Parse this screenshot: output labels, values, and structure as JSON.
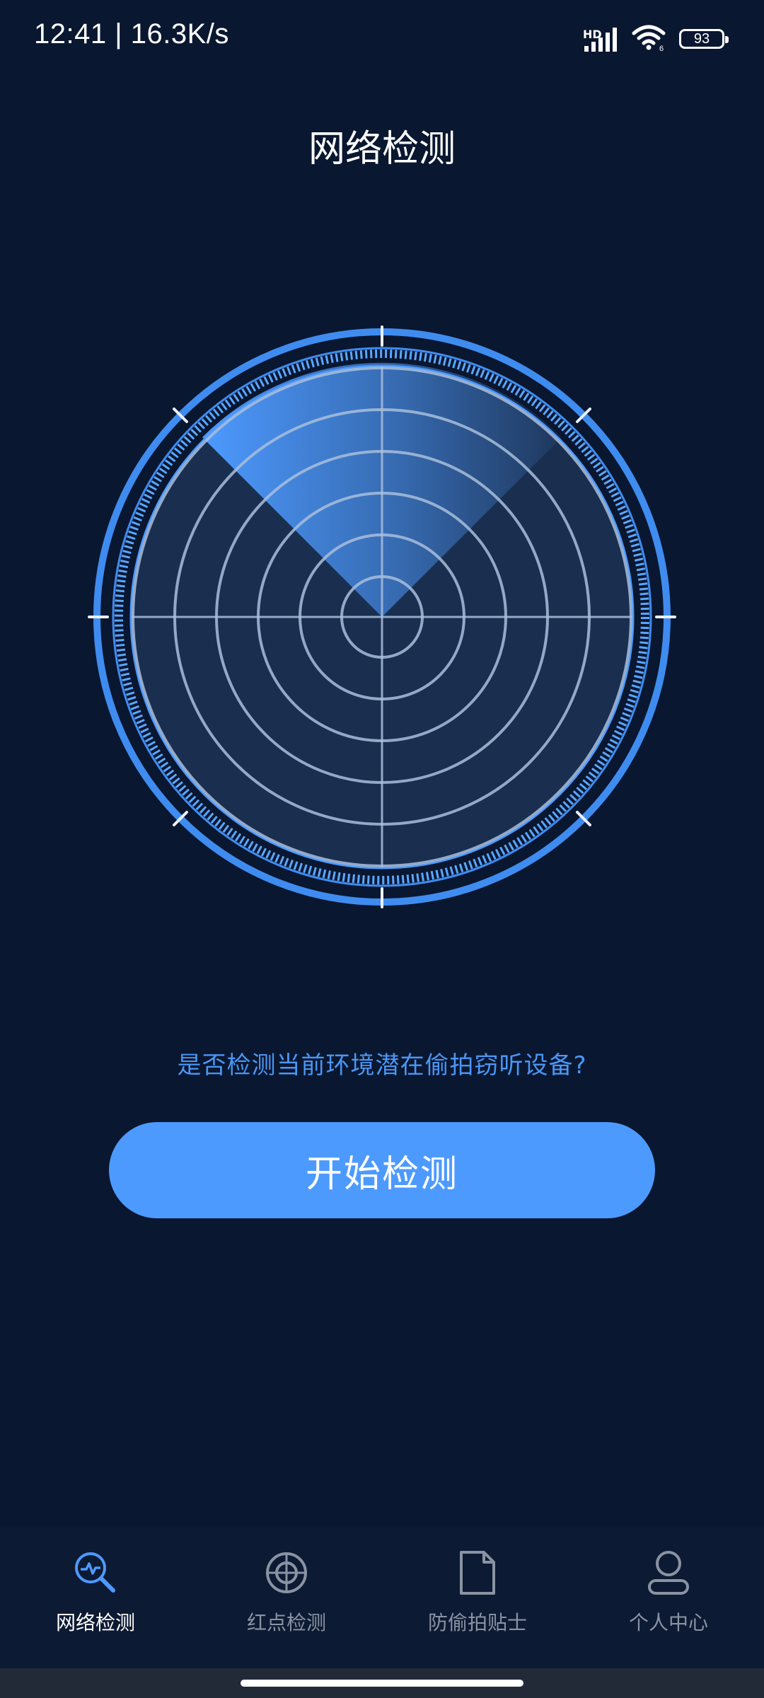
{
  "status_bar": {
    "time": "12:41 | 16.3K/s",
    "hd_label": "HD",
    "battery": "93",
    "icons": [
      "signal-icon",
      "wifi-icon",
      "battery-icon"
    ]
  },
  "header": {
    "title": "网络检测"
  },
  "main": {
    "radar_icon": "radar-icon",
    "prompt": "是否检测当前环境潜在偷拍窃听设备?",
    "start_button": "开始检测"
  },
  "bottom_nav": {
    "items": [
      {
        "label": "网络检测",
        "icon": "network-scan-icon",
        "active": true
      },
      {
        "label": "红点检测",
        "icon": "crosshair-icon",
        "active": false
      },
      {
        "label": "防偷拍贴士",
        "icon": "document-icon",
        "active": false
      },
      {
        "label": "个人中心",
        "icon": "user-icon",
        "active": false
      }
    ]
  },
  "colors": {
    "background": "#0a1730",
    "accent": "#4d9aff",
    "prompt_text": "#4a96f5",
    "nav_inactive": "#8a93a3"
  }
}
